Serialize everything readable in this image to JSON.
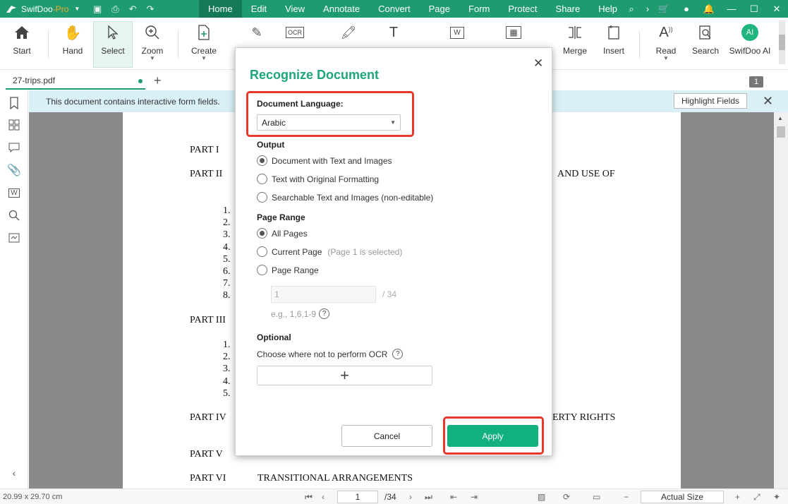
{
  "app": {
    "brand": "SwifDoo",
    "edition": "-Pro"
  },
  "menu": [
    "Home",
    "Edit",
    "View",
    "Annotate",
    "Convert",
    "Page",
    "Form",
    "Protect",
    "Share",
    "Help"
  ],
  "toolbar": {
    "start": "Start",
    "hand": "Hand",
    "select": "Select",
    "zoom": "Zoom",
    "create": "Create",
    "merge": "Merge",
    "insert": "Insert",
    "read": "Read",
    "search": "Search",
    "ai": "SwifDoo AI",
    "ai_badge": "AI"
  },
  "tab": {
    "filename": "27-trips.pdf",
    "page_badge": "1"
  },
  "infobar": {
    "message": "This document contains interactive form fields.",
    "highlight_button": "Highlight Fields"
  },
  "document": {
    "part1": "PART I",
    "part2": "PART II",
    "part2_tail": "AND  USE  OF",
    "list_a": [
      "1.",
      "2.",
      "3.",
      "4.",
      "5.",
      "6.",
      "7.",
      "8."
    ],
    "part3": "PART III",
    "list_b": [
      "1.",
      "2.",
      "3.",
      "4.",
      "5."
    ],
    "part4": "PART IV",
    "part4_tail": "ERTY RIGHTS",
    "part5": "PART V",
    "part6": "PART VI",
    "part6_text": "TRANSITIONAL ARRANGEMENTS"
  },
  "dialog": {
    "title": "Recognize Document",
    "language_label": "Document Language:",
    "language_value": "Arabic",
    "output_label": "Output",
    "output_options": [
      "Document with Text and Images",
      "Text with Original Formatting",
      "Searchable Text and Images (non-editable)"
    ],
    "page_range_label": "Page Range",
    "range_all": "All Pages",
    "range_current": "Current Page",
    "range_current_note": "(Page 1 is selected)",
    "range_custom": "Page Range",
    "range_input": "1",
    "range_total": "/ 34",
    "range_example": "e.g., 1,6,1-9",
    "optional_label": "Optional",
    "choose_text": "Choose where not to perform OCR",
    "cancel": "Cancel",
    "apply": "Apply"
  },
  "status": {
    "size": "20.99 x 29.70 cm",
    "page_input": "1",
    "page_total": "/34",
    "zoom": "Actual Size"
  },
  "colors": {
    "brand_green": "#1f9b70",
    "apply_green": "#13b07f",
    "highlight_red": "#e5392e",
    "info_bar": "#d9f0f7"
  }
}
